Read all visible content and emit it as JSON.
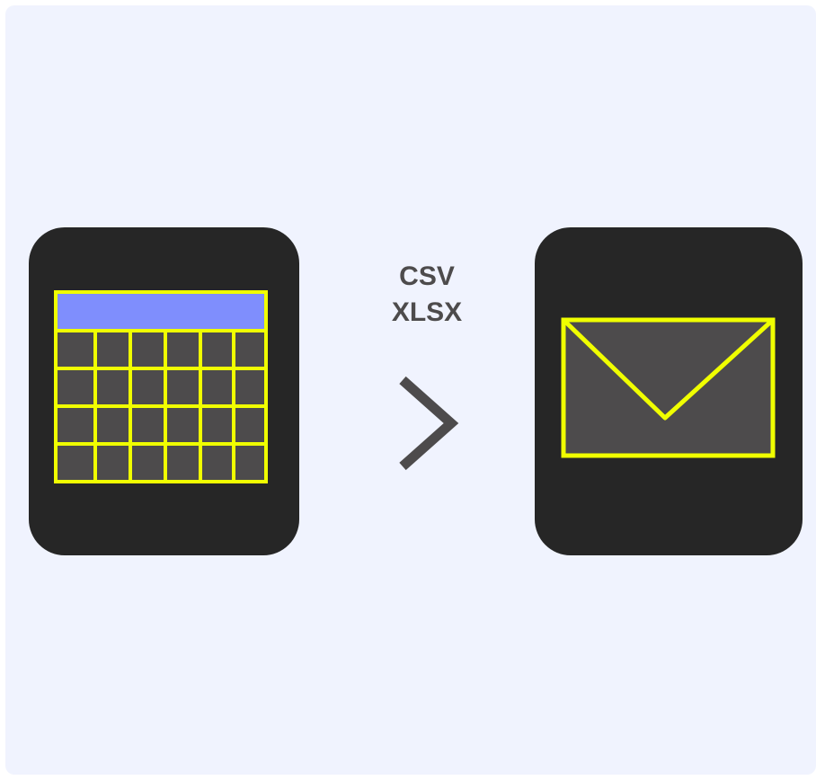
{
  "formats": [
    "CSV",
    "XLSX"
  ],
  "icons": {
    "source": "spreadsheet-icon",
    "arrow": "chevron-right-icon",
    "destination": "envelope-icon"
  },
  "colors": {
    "background": "#f0f3fe",
    "tile": "#262626",
    "outline": "#f0ff00",
    "cell": "#4d4b4c",
    "header": "#7f8efd",
    "text": "#4d4b4c"
  }
}
